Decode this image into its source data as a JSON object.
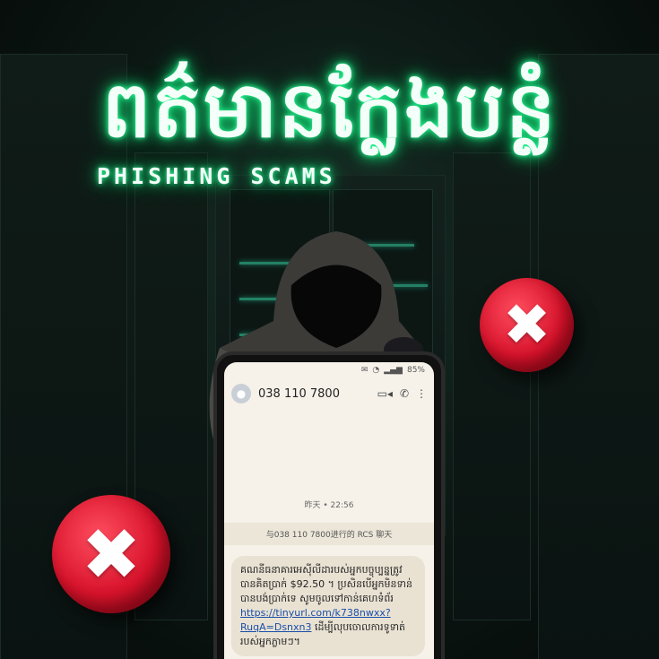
{
  "title": {
    "khmer": "ពត៌មានក្លែងបន្លំ",
    "english": "PHISHING SCAMS"
  },
  "phone": {
    "status": {
      "battery": "85%"
    },
    "contact": "038 110 7800",
    "date": "昨天 • 22:56",
    "rcs_notice": "与038 110 7800进行的 RCS 聊天",
    "message": {
      "text_before": "គណនីធនាគារអេស៊ីលីដារបស់អ្នកបច្ចុប្បន្នត្រូវបានគិតប្រាក់ $92.50 ។ ប្រសិនបើអ្នកមិនទាន់បានបង់ប្រាក់ទេ សូមចូលទៅកាន់គេហទំព័រ ",
      "link": "https://tinyurl.com/k738nwxx?RuqA=Dsnxn3",
      "text_after": " ដើម្បីលុបចោលការទូទាត់របស់អ្នកភ្លាមៗ។"
    }
  },
  "colors": {
    "title_glow": "#2cff9a",
    "x_red": "#d8132c"
  }
}
